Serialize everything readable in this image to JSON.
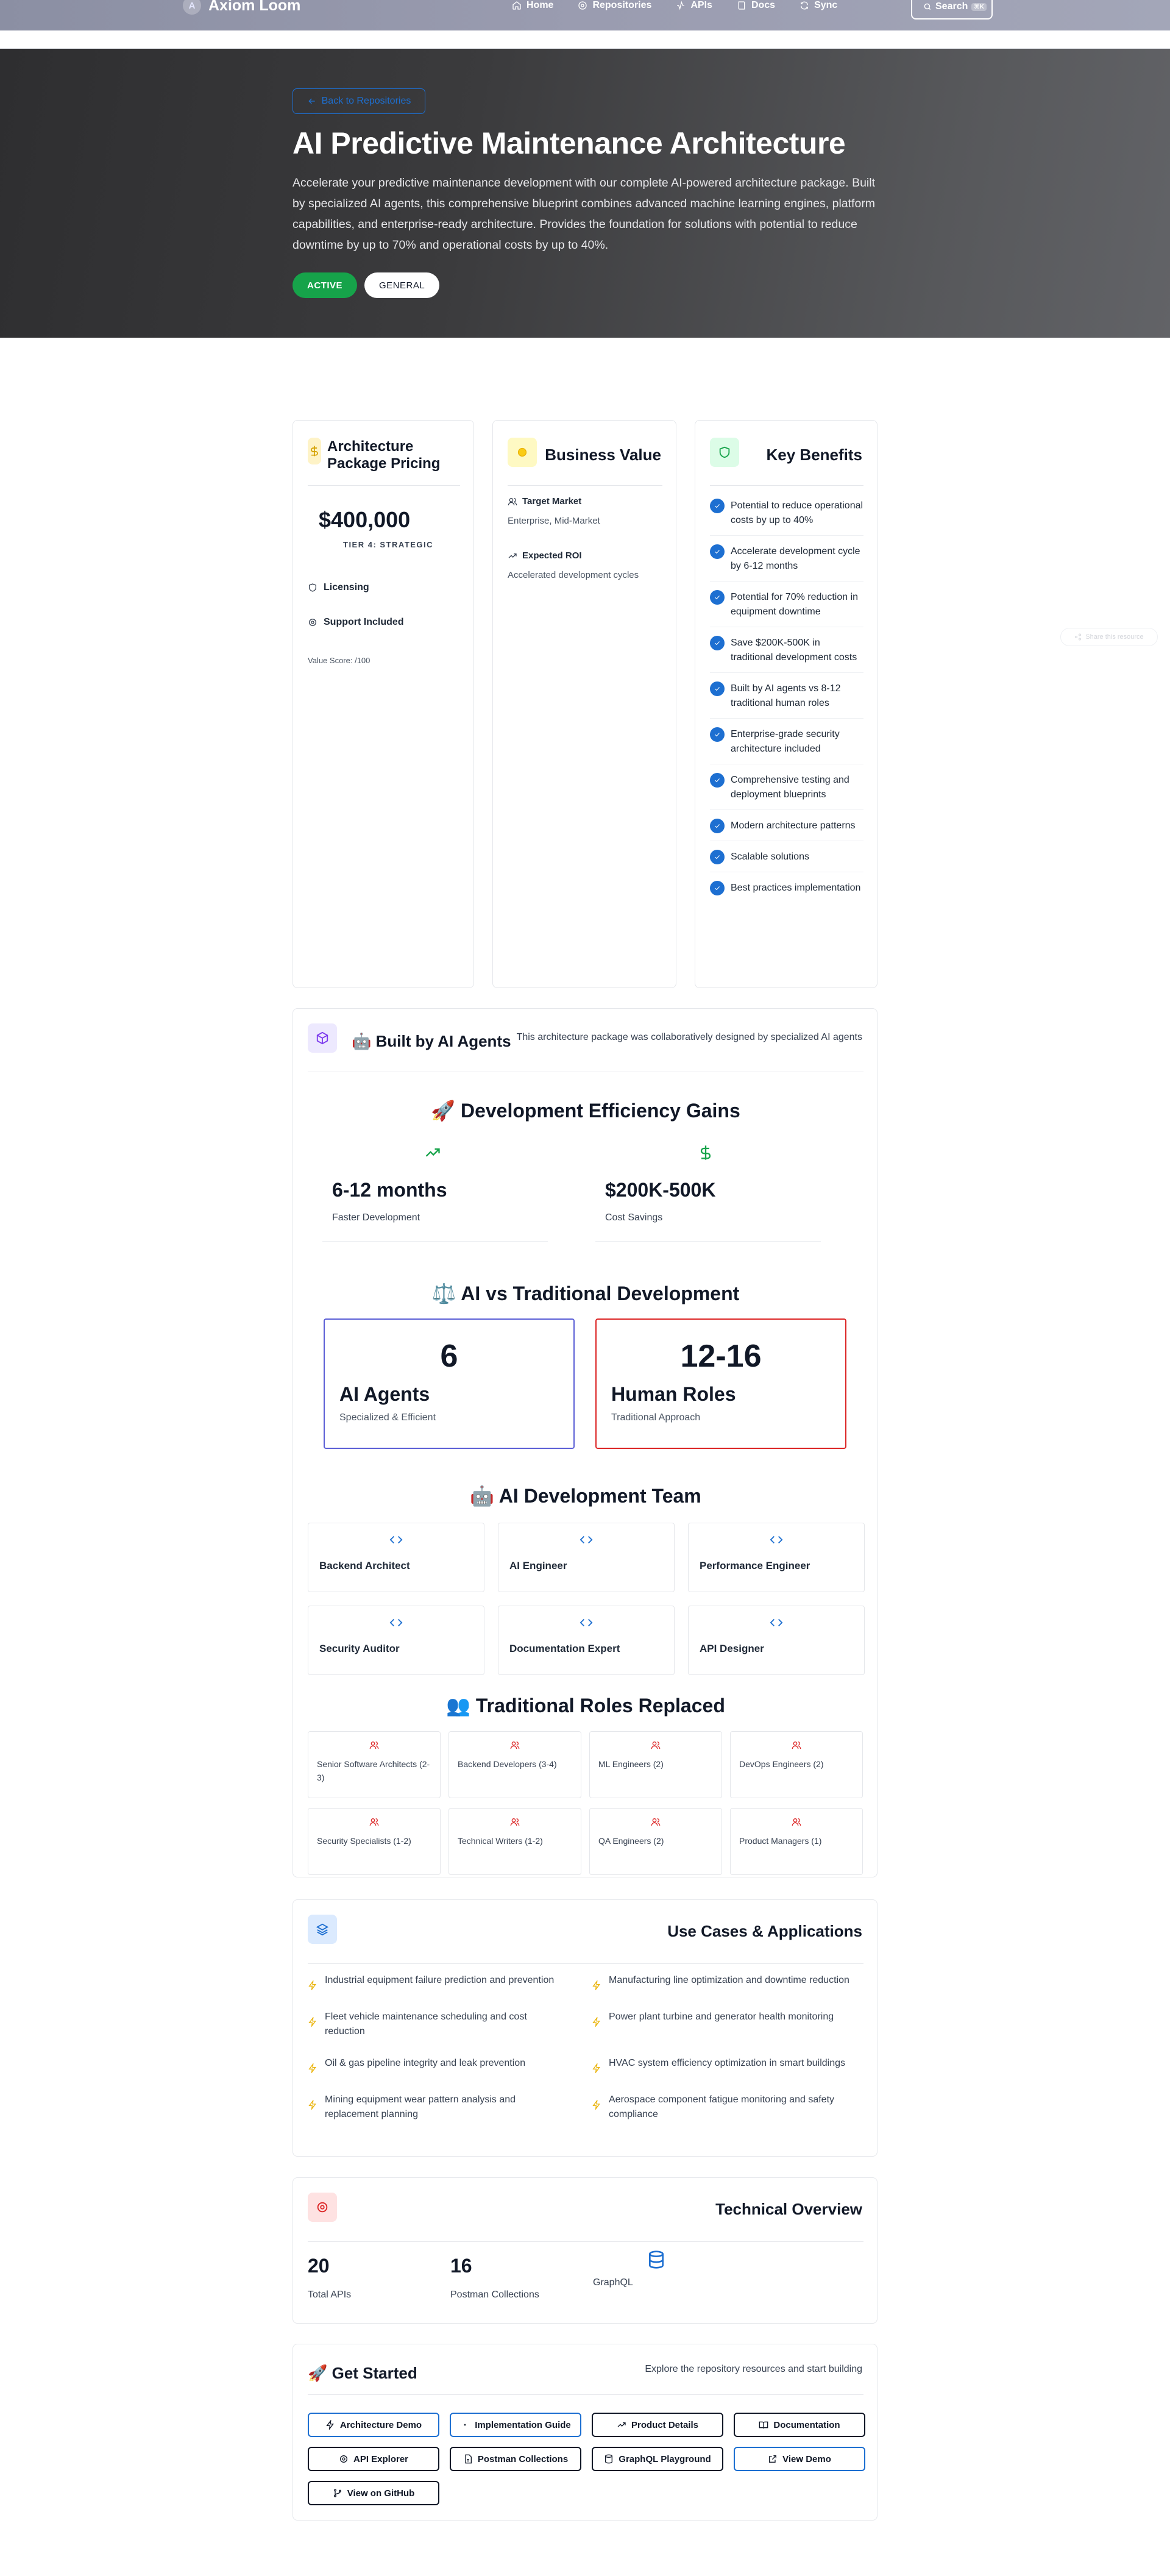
{
  "nav": {
    "brand": "Axiom Loom",
    "logo_letter": "A",
    "links": [
      {
        "label": "Home",
        "icon": "home-icon"
      },
      {
        "label": "Repositories",
        "icon": "gear-icon"
      },
      {
        "label": "APIs",
        "icon": "activity-icon"
      },
      {
        "label": "Docs",
        "icon": "book-icon"
      },
      {
        "label": "Sync",
        "icon": "refresh-icon"
      }
    ],
    "search_label": "Search",
    "search_kbd": "⌘K"
  },
  "hero": {
    "back_label": "Back to Repositories",
    "title": "AI Predictive Maintenance Architecture",
    "description": "Accelerate your predictive maintenance development with our complete AI-powered architecture package. Built by specialized AI agents, this comprehensive blueprint combines advanced machine learning engines, platform capabilities, and enterprise-ready architecture. Provides the foundation for solutions with potential to reduce downtime by up to 70% and operational costs by up to 40%.",
    "badge_status": "ACTIVE",
    "badge_category": "GENERAL"
  },
  "pricing": {
    "title": "Architecture Package Pricing",
    "price": "$400,000",
    "tier": "TIER 4: STRATEGIC",
    "licensing": "Licensing",
    "support": "Support Included",
    "value_score": "Value Score: /100"
  },
  "business_value": {
    "title": "Business Value",
    "target_market_label": "Target Market",
    "target_market_value": "Enterprise, Mid-Market",
    "roi_label": "Expected ROI",
    "roi_value": "Accelerated development cycles"
  },
  "benefits": {
    "title": "Key Benefits",
    "items": [
      "Potential to reduce operational costs by up to 40%",
      "Accelerate development cycle by 6-12 months",
      "Potential for 70% reduction in equipment downtime",
      "Save $200K-500K in traditional development costs",
      "Built by AI agents vs 8-12 traditional human roles",
      "Enterprise-grade security architecture included",
      "Comprehensive testing and deployment blueprints",
      "Modern architecture patterns",
      "Scalable solutions",
      "Best practices implementation"
    ]
  },
  "built": {
    "title": "🤖 Built by AI Agents",
    "subtitle": "This architecture package was collaboratively designed by specialized AI agents",
    "efficiency_title": "🚀 Development Efficiency Gains",
    "efficiency": [
      {
        "value": "6-12 months",
        "label": "Faster Development",
        "icon": "trending-up-icon",
        "color": "#16a34a"
      },
      {
        "value": "$200K-500K",
        "label": "Cost Savings",
        "icon": "dollar-icon",
        "color": "#16a34a"
      }
    ],
    "vs_title": "⚖️ AI vs Traditional Development",
    "ai_count": "6",
    "ai_label": "AI Agents",
    "ai_desc": "Specialized & Efficient",
    "human_count": "12-16",
    "human_label": "Human Roles",
    "human_desc": "Traditional Approach",
    "team_title": "🤖 AI Development Team",
    "team": [
      "Backend Architect",
      "AI Engineer",
      "Performance Engineer",
      "Security Auditor",
      "Documentation Expert",
      "API Designer"
    ],
    "roles_title": "👥 Traditional Roles Replaced",
    "roles": [
      "Senior Software Architects (2-3)",
      "Backend Developers (3-4)",
      "ML Engineers (2)",
      "DevOps Engineers (2)",
      "Security Specialists (1-2)",
      "Technical Writers (1-2)",
      "QA Engineers (2)",
      "Product Managers (1)"
    ]
  },
  "use_cases": {
    "title": "Use Cases & Applications",
    "items": [
      "Industrial equipment failure prediction and prevention",
      "Manufacturing line optimization and downtime reduction",
      "Fleet vehicle maintenance scheduling and cost reduction",
      "Power plant turbine and generator health monitoring",
      "Oil & gas pipeline integrity and leak prevention",
      "HVAC system efficiency optimization in smart buildings",
      "Mining equipment wear pattern analysis and replacement planning",
      "Aerospace component fatigue monitoring and safety compliance"
    ]
  },
  "tech": {
    "title": "Technical Overview",
    "apis_count": "20",
    "apis_label": "Total APIs",
    "postman_count": "16",
    "postman_label": "Postman Collections",
    "graphql_label": "GraphQL"
  },
  "get_started": {
    "title": "🚀 Get Started",
    "subtitle": "Explore the repository resources and start building",
    "buttons": [
      {
        "label": "Architecture Demo",
        "icon": "zap-icon",
        "accent": "blue"
      },
      {
        "label": "Implementation Guide",
        "icon": "dot-icon",
        "accent": "blue"
      },
      {
        "label": "Product Details",
        "icon": "trending-up-icon",
        "accent": "dark"
      },
      {
        "label": "Documentation",
        "icon": "book-icon",
        "accent": "dark"
      },
      {
        "label": "API Explorer",
        "icon": "gear-icon",
        "accent": "dark"
      },
      {
        "label": "Postman Collections",
        "icon": "file-icon",
        "accent": "dark"
      },
      {
        "label": "GraphQL Playground",
        "icon": "database-icon",
        "accent": "dark"
      },
      {
        "label": "View Demo",
        "icon": "external-link-icon",
        "accent": "blue"
      },
      {
        "label": "View on GitHub",
        "icon": "git-branch-icon",
        "accent": "dark"
      }
    ]
  },
  "floating": {
    "label": "Share this resource"
  },
  "colors": {
    "accent_blue": "#1d6fd1",
    "success_green": "#16a34a",
    "danger_red": "#dc2626",
    "ai_purple": "#5b5fd6"
  }
}
